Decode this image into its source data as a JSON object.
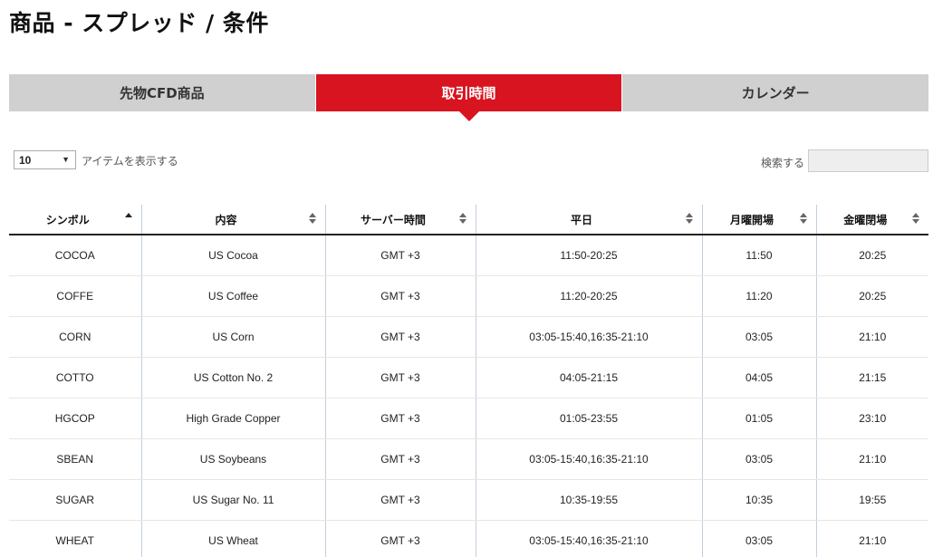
{
  "page": {
    "title": "商品 - スプレッド / 条件"
  },
  "tabs": [
    {
      "label": "先物CFD商品",
      "active": false
    },
    {
      "label": "取引時間",
      "active": true
    },
    {
      "label": "カレンダー",
      "active": false
    }
  ],
  "colors": {
    "accent": "#d7141f",
    "tab_inactive": "#d0d0d0"
  },
  "controls": {
    "length_value": "10",
    "length_label": "アイテムを表示する",
    "search_label": "検索する",
    "search_value": ""
  },
  "table": {
    "columns": [
      "シンボル",
      "内容",
      "サーバー時間",
      "平日",
      "月曜開場",
      "金曜閉場"
    ],
    "sorted_column": "シンボル",
    "sort_direction": "ascending",
    "rows": [
      [
        "COCOA",
        "US Cocoa",
        "GMT +3",
        "11:50-20:25",
        "11:50",
        "20:25"
      ],
      [
        "COFFE",
        "US Coffee",
        "GMT +3",
        "11:20-20:25",
        "11:20",
        "20:25"
      ],
      [
        "CORN",
        "US Corn",
        "GMT +3",
        "03:05-15:40,16:35-21:10",
        "03:05",
        "21:10"
      ],
      [
        "COTTO",
        "US Cotton No. 2",
        "GMT +3",
        "04:05-21:15",
        "04:05",
        "21:15"
      ],
      [
        "HGCOP",
        "High Grade Copper",
        "GMT +3",
        "01:05-23:55",
        "01:05",
        "23:10"
      ],
      [
        "SBEAN",
        "US Soybeans",
        "GMT +3",
        "03:05-15:40,16:35-21:10",
        "03:05",
        "21:10"
      ],
      [
        "SUGAR",
        "US Sugar No. 11",
        "GMT +3",
        "10:35-19:55",
        "10:35",
        "19:55"
      ],
      [
        "WHEAT",
        "US Wheat",
        "GMT +3",
        "03:05-15:40,16:35-21:10",
        "03:05",
        "21:10"
      ]
    ]
  }
}
